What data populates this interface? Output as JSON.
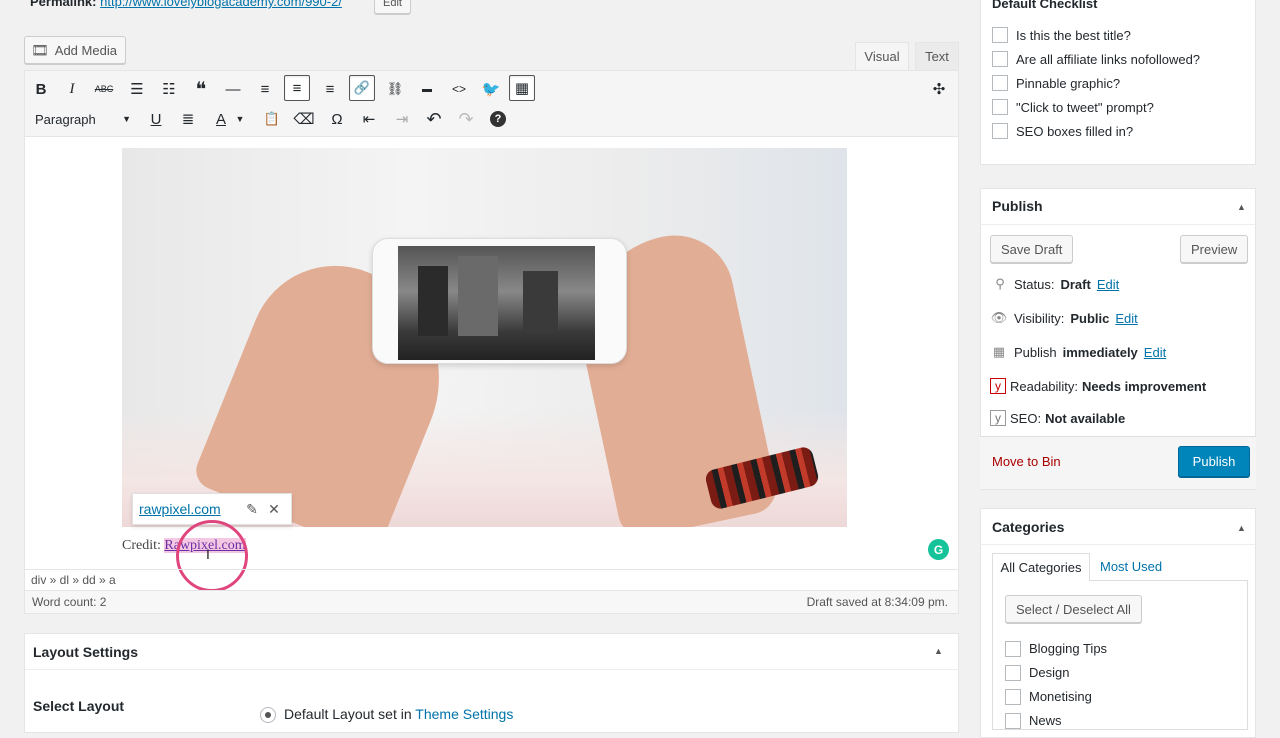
{
  "permalink": {
    "label": "Permalink:",
    "url": "http://www.lovelyblogacademy.com/990-2/",
    "edit": "Edit"
  },
  "editor": {
    "add_media": "Add Media",
    "tab_visual": "Visual",
    "tab_text": "Text",
    "format_select": "Paragraph",
    "toolbar_row1": [
      {
        "name": "bold",
        "glyph": "B"
      },
      {
        "name": "italic",
        "glyph": "I"
      },
      {
        "name": "strikethrough",
        "glyph": "ABC"
      },
      {
        "name": "bulleted-list",
        "glyph": "☰"
      },
      {
        "name": "numbered-list",
        "glyph": "☷"
      },
      {
        "name": "blockquote",
        "glyph": "❝"
      },
      {
        "name": "horizontal-line",
        "glyph": "—"
      },
      {
        "name": "align-left",
        "glyph": "≡"
      },
      {
        "name": "align-center",
        "glyph": "≡"
      },
      {
        "name": "align-right",
        "glyph": "≡"
      },
      {
        "name": "insert-link",
        "glyph": "🔗"
      },
      {
        "name": "remove-link",
        "glyph": "⛓"
      },
      {
        "name": "read-more",
        "glyph": "▬"
      },
      {
        "name": "code",
        "glyph": "<>"
      },
      {
        "name": "twitter",
        "glyph": "🐦"
      },
      {
        "name": "toolbar-toggle",
        "glyph": "▦"
      }
    ],
    "toolbar_row2": [
      {
        "name": "underline",
        "glyph": "U"
      },
      {
        "name": "justify",
        "glyph": "≣"
      },
      {
        "name": "text-color",
        "glyph": "A"
      },
      {
        "name": "paste-text",
        "glyph": "📋"
      },
      {
        "name": "clear-formatting",
        "glyph": "⌫"
      },
      {
        "name": "special-character",
        "glyph": "Ω"
      },
      {
        "name": "outdent",
        "glyph": "⇤"
      },
      {
        "name": "indent",
        "glyph": "⇥"
      },
      {
        "name": "undo",
        "glyph": "↶"
      },
      {
        "name": "redo",
        "glyph": "↷"
      },
      {
        "name": "help",
        "glyph": "?"
      }
    ],
    "link_popup_url": "rawpixel.com",
    "credit_prefix": "Credit: ",
    "credit_link": "Rawpixel.com",
    "path": "div » dl » dd » a",
    "word_count": "Word count: 2",
    "draft_saved": "Draft saved at 8:34:09 pm."
  },
  "layout_settings": {
    "title": "Layout Settings",
    "select_layout": "Select Layout",
    "option_prefix": "Default Layout set in ",
    "option_link": "Theme Settings"
  },
  "checklist": {
    "title": "Default Checklist",
    "items": [
      "Is this the best title?",
      "Are all affiliate links nofollowed?",
      "Pinnable graphic?",
      "\"Click to tweet\" prompt?",
      "SEO boxes filled in?"
    ]
  },
  "publish": {
    "title": "Publish",
    "save_draft": "Save Draft",
    "preview": "Preview",
    "status_label": "Status:",
    "status_value": "Draft",
    "visibility_label": "Visibility:",
    "visibility_value": "Public",
    "publish_label": "Publish",
    "publish_value": "immediately",
    "edit": "Edit",
    "readability_label": "Readability:",
    "readability_value": "Needs improvement",
    "seo_label": "SEO:",
    "seo_value": "Not available",
    "move_to_bin": "Move to Bin",
    "publish_button": "Publish"
  },
  "categories": {
    "title": "Categories",
    "tab_all": "All Categories",
    "tab_most_used": "Most Used",
    "select_button": "Select / Deselect All",
    "items": [
      "Blogging Tips",
      "Design",
      "Monetising",
      "News"
    ]
  },
  "colors": {
    "accent": "#0073aa",
    "publish": "#0085ba",
    "danger": "#a00",
    "click_ring": "#e0467e"
  }
}
